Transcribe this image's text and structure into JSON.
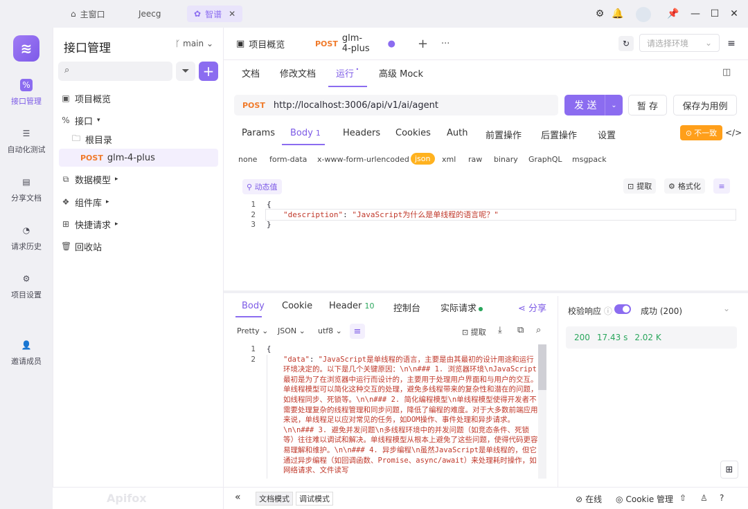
{
  "window_tabs": [
    {
      "label": "主窗口",
      "icon": "home-icon"
    },
    {
      "label": "Jeecg"
    },
    {
      "label": "智谱",
      "icon": "brain-icon",
      "active": true
    }
  ],
  "left_nav": [
    {
      "label": "接口管理",
      "icon": "api-icon",
      "active": true
    },
    {
      "label": "自动化测试",
      "icon": "automation-icon"
    },
    {
      "label": "分享文档",
      "icon": "share-doc-icon"
    },
    {
      "label": "请求历史",
      "icon": "history-icon"
    },
    {
      "label": "项目设置",
      "icon": "settings-icon"
    },
    {
      "label": "邀请成员",
      "icon": "invite-icon"
    }
  ],
  "sidebar": {
    "title": "接口管理",
    "branch": "main",
    "tree": [
      {
        "label": "项目概览"
      },
      {
        "label": "接口"
      },
      {
        "label": "根目录"
      },
      {
        "method": "POST",
        "label": "glm-4-plus"
      },
      {
        "label": "数据模型"
      },
      {
        "label": "组件库"
      },
      {
        "label": "快捷请求"
      },
      {
        "label": "回收站"
      }
    ]
  },
  "doc_tabs": {
    "overview": "项目概览",
    "active_method": "POST",
    "active_label": "glm-4-plus",
    "env_placeholder": "请选择环境"
  },
  "sub_tabs": [
    "文档",
    "修改文档",
    "运行",
    "高级 Mock"
  ],
  "request": {
    "method": "POST",
    "url": "http://localhost:3006/api/v1/ai/agent",
    "send": "发 送",
    "save": "暂 存",
    "save_case": "保存为用例"
  },
  "param_tabs": [
    "Params",
    "Body",
    "Headers",
    "Cookies",
    "Auth",
    "前置操作",
    "后置操作",
    "设置"
  ],
  "body_count": "1",
  "mismatch": "不一致",
  "content_types": [
    "none",
    "form-data",
    "x-www-form-urlencoded",
    "json",
    "xml",
    "raw",
    "binary",
    "GraphQL",
    "msgpack"
  ],
  "editor_tools": {
    "dynamic": "动态值",
    "extract": "提取",
    "format": "格式化"
  },
  "request_body": {
    "line1": "{",
    "key": "\"description\"",
    "value": "\"JavaScript为什么是单线程的语言呢？\"",
    "line3": "}"
  },
  "response_tabs": [
    "Body",
    "Cookie",
    "Header",
    "控制台",
    "实际请求"
  ],
  "header_count": "10",
  "share": "分享",
  "response_format": {
    "view": "Pretty",
    "type": "JSON",
    "encoding": "utf8",
    "extract": "提取"
  },
  "response_body": {
    "line1": "{",
    "key": "\"data\"",
    "text": "\"JavaScript是单线程的语言，主要是由其最初的设计用途和运行环境决定的。以下是几个关键原因：\\n\\n### 1. 浏览器环境\\nJavaScript最初是为了在浏览器中运行而设计的，主要用于处理用户界面和与用户的交互。单线程模型可以简化这种交互的处理，避免多线程带来的复杂性和潜在的问题，如线程同步、死锁等。\\n\\n### 2. 简化编程模型\\n单线程模型使得开发者不需要处理复杂的线程管理和同步问题，降低了编程的难度。对于大多数前端应用来说，单线程足以应对常见的任务，如DOM操作、事件处理和异步请求。\\n\\n### 3. 避免并发问题\\n多线程环境中的并发问题（如竞态条件、死锁等）往往难以调试和解决。单线程模型从根本上避免了这些问题，使得代码更容易理解和维护。\\n\\n### 4. 异步编程\\n虽然JavaScript是单线程的，但它通过异步编程（如回调函数、Promise、async/await）来处理耗时操作，如网络请求、文件读写"
  },
  "validation": {
    "label": "校验响应",
    "result": "成功 (200)"
  },
  "stats": {
    "status": "200",
    "time": "17.43 s",
    "size": "2.02 K"
  },
  "status_bar": {
    "doc_mode": "文档模式",
    "debug_mode": "调试模式",
    "online": "在线",
    "cookie": "Cookie 管理"
  },
  "watermark": "Apifox",
  "colors": {
    "accent": "#8b6cf0",
    "post": "#f07a2a",
    "warning": "#ff9f1a",
    "success": "#2aa65c"
  }
}
